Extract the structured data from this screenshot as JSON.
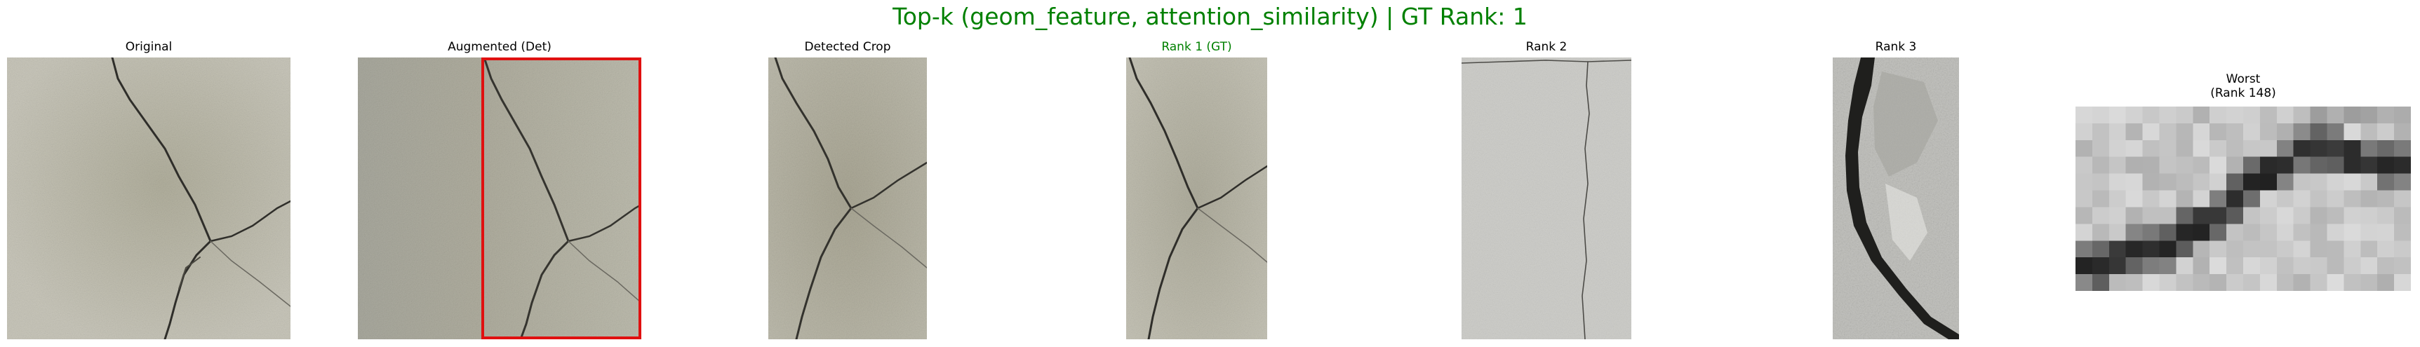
{
  "figure": {
    "title": "Top-k (geom_feature, attention_similarity) | GT Rank: 1",
    "title_color": "#008000"
  },
  "panels": [
    {
      "title": "Original"
    },
    {
      "title": "Augmented (Det)",
      "box_color": "#e01010"
    },
    {
      "title": "Detected Crop"
    },
    {
      "title": "Rank 1 (GT)",
      "title_color": "#008000"
    },
    {
      "title": "Rank 2"
    },
    {
      "title": "Rank 3"
    },
    {
      "title": "Worst\n(Rank 148)"
    }
  ]
}
